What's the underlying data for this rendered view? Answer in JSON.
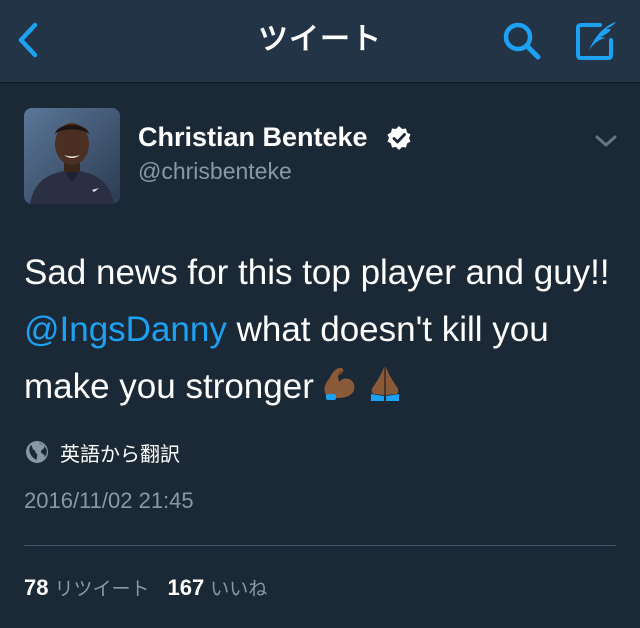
{
  "navbar": {
    "title": "ツイート",
    "back_icon": "chevron-left-icon",
    "search_icon": "search-icon",
    "compose_icon": "compose-tweet-icon"
  },
  "colors": {
    "navbar_bg": "#243447",
    "page_bg": "#1b2836",
    "accent": "#1da1f2",
    "secondary_text": "#8899a6"
  },
  "tweet": {
    "author": {
      "name": "Christian Benteke",
      "handle": "@chrisbenteke",
      "verified": true
    },
    "text_before": "Sad news for this top player and guy!! ",
    "mention": "@IngsDanny",
    "text_after": " what doesn't kill you make you stronger",
    "emojis": [
      "flexed-biceps-emoji",
      "folded-hands-emoji"
    ],
    "translate_label": "英語から翻訳",
    "timestamp": "2016/11/02 21:45",
    "retweet_count": "78",
    "retweet_label": "リツイート",
    "like_count": "167",
    "like_label": "いいね"
  }
}
